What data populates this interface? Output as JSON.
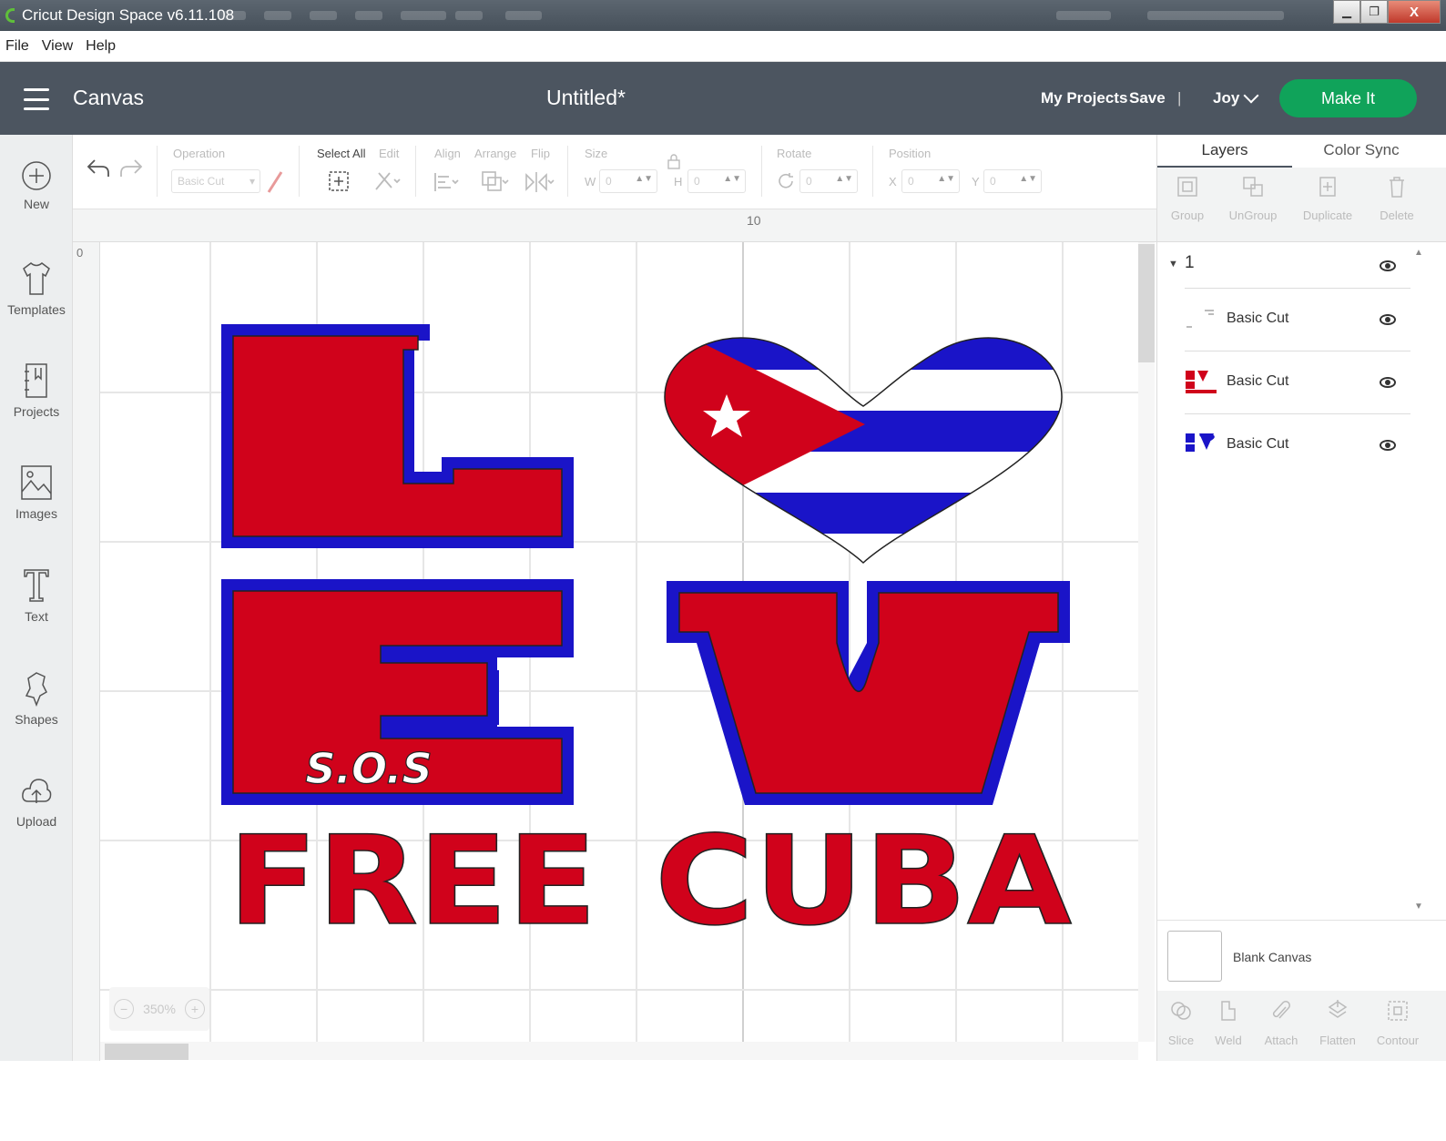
{
  "window": {
    "title": "Cricut Design Space  v6.11.108",
    "close_label": "X"
  },
  "menu": {
    "items": [
      "File",
      "View",
      "Help"
    ]
  },
  "header": {
    "section": "Canvas",
    "doc_title": "Untitled*",
    "my_projects": "My Projects",
    "save": "Save",
    "separator": "|",
    "user": "Joy",
    "make_it": "Make It",
    "accent_color": "#10a35a",
    "bar_color": "#4c5560"
  },
  "sidebar": {
    "items": [
      {
        "label": "New",
        "icon": "plus-circle-icon"
      },
      {
        "label": "Templates",
        "icon": "tshirt-icon"
      },
      {
        "label": "Projects",
        "icon": "projects-icon"
      },
      {
        "label": "Images",
        "icon": "image-icon"
      },
      {
        "label": "Text",
        "icon": "text-icon"
      },
      {
        "label": "Shapes",
        "icon": "shapes-icon"
      },
      {
        "label": "Upload",
        "icon": "upload-icon"
      }
    ]
  },
  "toolbar": {
    "operation_label": "Operation",
    "operation_value": "Basic Cut",
    "select_all": "Select All",
    "edit": "Edit",
    "align": "Align",
    "arrange": "Arrange",
    "flip": "Flip",
    "size": "Size",
    "w": "W",
    "w_value": "0",
    "h": "H",
    "h_value": "0",
    "rotate": "Rotate",
    "rotate_value": "0",
    "position": "Position",
    "x": "X",
    "x_value": "0",
    "y": "Y",
    "y_value": "0"
  },
  "canvas": {
    "ruler_top_mark": "10",
    "ruler_left_mark": "0",
    "zoom_level": "350%",
    "zoom_minus": "−",
    "zoom_plus": "+",
    "design": {
      "letter_l": "L",
      "letter_e": "E",
      "letter_v": "V",
      "sos_text": "S.O.S",
      "free_text": "FREE",
      "cuba_text": "CUBA",
      "red": "#d0021b",
      "blue": "#1a14c8"
    }
  },
  "panel": {
    "tabs": [
      "Layers",
      "Color Sync"
    ],
    "tools": [
      "Group",
      "UnGroup",
      "Duplicate",
      "Delete"
    ],
    "group_name": "1",
    "layers": [
      {
        "name": "Basic Cut"
      },
      {
        "name": "Basic Cut"
      },
      {
        "name": "Basic Cut"
      }
    ],
    "blank_canvas": "Blank Canvas",
    "bottom_tools": [
      "Slice",
      "Weld",
      "Attach",
      "Flatten",
      "Contour"
    ]
  }
}
